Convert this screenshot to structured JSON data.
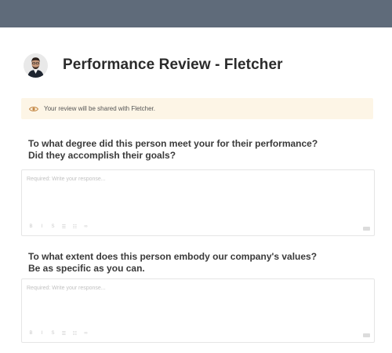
{
  "header": {
    "title": "Performance Review - Fletcher"
  },
  "notice": {
    "text": "Your review will be shared with Fletcher.",
    "icon": "eye-icon",
    "accent": "#c0803a",
    "background": "#fdf5e6"
  },
  "questions": [
    {
      "line1": "To what degree did this person meet your  for their performance?",
      "line2": "Did they accomplish their goals?",
      "placeholder": "Required: Write your response..."
    },
    {
      "line1": "To what extent does this person embody our company's values?",
      "line2": "Be as specific as you can.",
      "placeholder": "Required: Write your response..."
    }
  ],
  "toolbar": {
    "bold": "B",
    "italic": "I",
    "strike": "S",
    "bullets": "☰",
    "numbered": "☷",
    "link": "∞"
  }
}
